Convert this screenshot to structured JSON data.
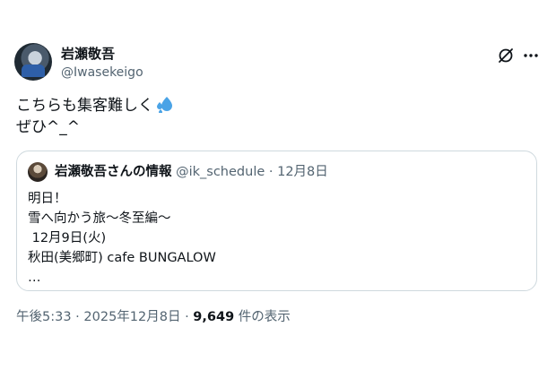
{
  "author": {
    "display_name": "岩瀬敬吾",
    "handle": "@Iwasekeigo"
  },
  "tweet": {
    "lines": [
      "こちらも集客難しく",
      "ぜひ^_^"
    ],
    "emoji": "sweat-droplets"
  },
  "quote": {
    "display_name": "岩瀬敬吾さんの情報",
    "handle": "@ik_schedule",
    "separator": " · ",
    "date": "12月8日",
    "lines": [
      "明日！",
      "雪へ向かう旅〜冬至編〜",
      " 12月9日(火)",
      "秋田(美郷町) cafe BUNGALOW",
      "…"
    ]
  },
  "footer": {
    "time": "午後5:33",
    "separator": " · ",
    "date": "2025年12月8日",
    "views": "9,649",
    "views_label": " 件の表示"
  },
  "colors": {
    "text": "#0f1419",
    "secondary": "#536471",
    "border": "#cfd9de",
    "emoji_blue": "#4aa3e6"
  }
}
